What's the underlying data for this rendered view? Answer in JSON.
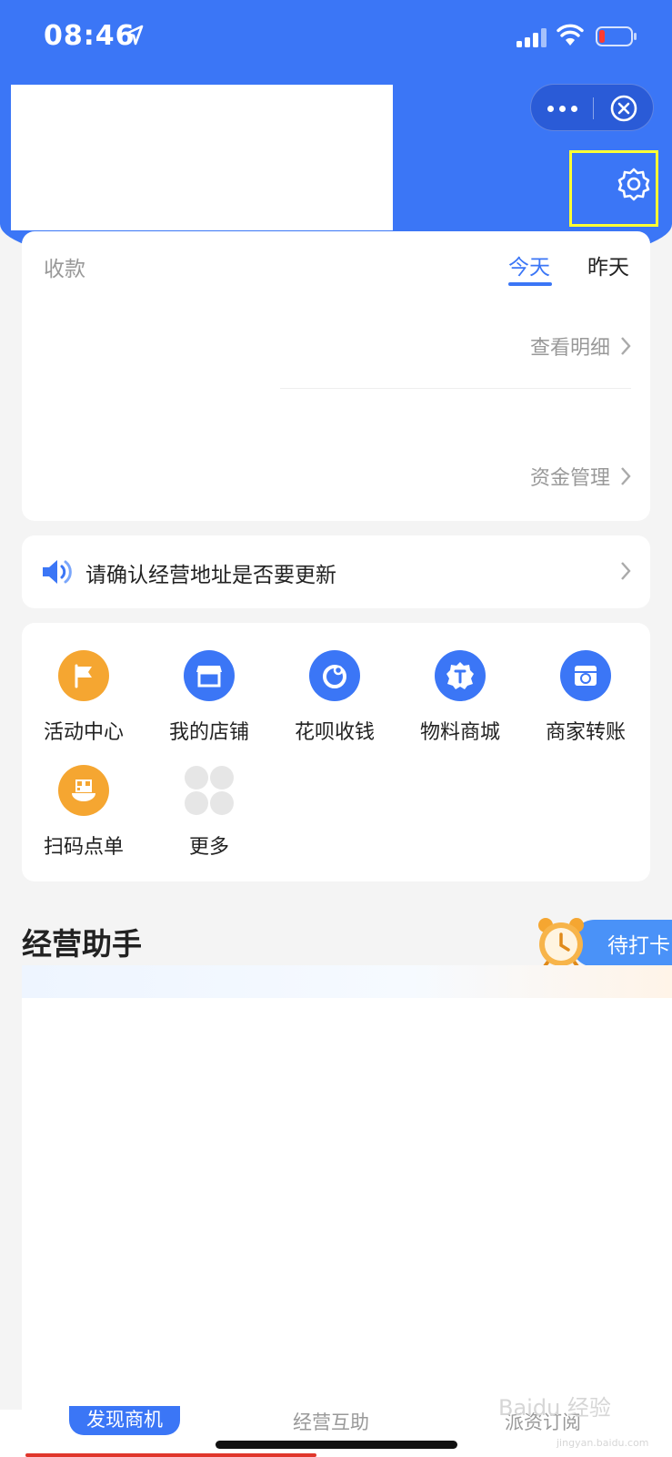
{
  "status_bar": {
    "time": "08:46"
  },
  "payment": {
    "label": "收款",
    "tabs": {
      "today": "今天",
      "yesterday": "昨天"
    },
    "view_detail": "查看明细",
    "fund_management": "资金管理"
  },
  "notice": {
    "text": "请确认经营地址是否要更新"
  },
  "grid": {
    "items": [
      {
        "label": "活动中心",
        "icon": "flag-icon",
        "color": "#f5a631"
      },
      {
        "label": "我的店铺",
        "icon": "store-icon",
        "color": "#3b76f6"
      },
      {
        "label": "花呗收钱",
        "icon": "huabei-icon",
        "color": "#3b76f6"
      },
      {
        "label": "物料商城",
        "icon": "material-mall-icon",
        "color": "#3b76f6"
      },
      {
        "label": "商家转账",
        "icon": "transfer-icon",
        "color": "#3b76f6"
      },
      {
        "label": "扫码点单",
        "icon": "scan-order-icon",
        "color": "#f5a631"
      },
      {
        "label": "更多",
        "icon": "more-grid-icon",
        "color": "#e6e6e6"
      }
    ]
  },
  "assistant": {
    "title": "经营助手",
    "pending_tag": "待打卡"
  },
  "bottom_tabs": {
    "discover": "发现商机",
    "assist": "经营互助",
    "third": "派资订阅"
  },
  "watermark": {
    "text": "Baidu 经验",
    "sub": "jingyan.baidu.com"
  },
  "colors": {
    "brand": "#3b76f6",
    "accent_orange": "#f5a631",
    "highlight": "#ffff33"
  }
}
